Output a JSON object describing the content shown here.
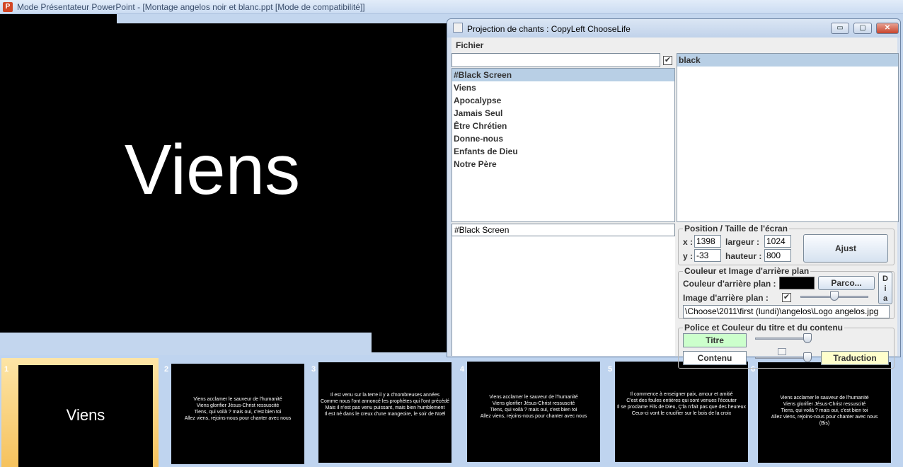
{
  "powerpoint": {
    "title": "Mode Présentateur PowerPoint - [Montage angelos noir et blanc.ppt [Mode de compatibilité]]",
    "current_slide_text": "Viens"
  },
  "slides": [
    {
      "number": "1",
      "lines": [
        "Viens"
      ]
    },
    {
      "number": "2",
      "lines": [
        "Viens acclamer le sauveur de l'humanité",
        "Viens glorifier Jésus-Christ  ressuscité",
        "Tiens, qui voilà ? mais oui, c'est bien toi",
        "Allez viens, rejoins-nous  pour chanter avec nous"
      ]
    },
    {
      "number": "3",
      "lines": [
        "Il est venu sur la terre il y a d'nombreuses années",
        "Comme nous l'ont annoncé les prophètes qui l'ont précédé",
        "Mais il n'est pas venu puissant, mais bien humblement",
        "Il est né dans le creux d'une mangeoire, le soir de Noël"
      ]
    },
    {
      "number": "4",
      "lines": [
        "Viens acclamer le sauveur de l'humanité",
        "Viens glorifier Jésus-Christ  ressuscité",
        "Tiens, qui voilà ? mais oui, c'est bien toi",
        "Allez viens, rejoins-nous  pour chanter avec nous"
      ]
    },
    {
      "number": "5",
      "lines": [
        "Il commence à enseigner paix, amour et amitié",
        "C'est des foules entières qui sont venues l'écouter",
        "Il se proclame Fils de Dieu, Ç'la n'fait pas que des heureux",
        "Ceux-ci vont le crucifier sur le bois de la croix"
      ]
    },
    {
      "number": "6",
      "lines": [
        "Viens acclamer le sauveur de l'humanité",
        "Viens glorifier Jésus-Christ  ressuscité",
        "Tiens, qui voilà ? mais oui, c'est bien toi",
        "Allez viens, rejoins-nous  pour chanter avec nous",
        "",
        "(Bis)"
      ]
    }
  ],
  "app": {
    "title": "Projection de chants : CopyLeft ChooseLife",
    "window_buttons": {
      "minimize": "▭",
      "maximize": "▢",
      "close": "✕"
    },
    "menu": {
      "fichier": "Fichier"
    },
    "search_value": "",
    "filter_checked": true,
    "songs": [
      "#Black Screen",
      "Viens",
      "Apocalypse",
      "Jamais Seul",
      "Être Chrétien",
      "Donne-nous",
      "Enfants de Dieu",
      "Notre Père"
    ],
    "selected_song": "#Black Screen",
    "slides_list": [
      "black"
    ],
    "current_title_field": "#Black Screen",
    "position": {
      "label": "Position / Taille de l'écran",
      "x_label": "x :",
      "x_value": "1398",
      "y_label": "y :",
      "y_value": "-33",
      "width_label": "largeur :",
      "width_value": "1024",
      "height_label": "hauteur :",
      "height_value": "800",
      "adjust_button": "Ajust"
    },
    "background": {
      "label": "Couleur et Image d'arrière plan",
      "color_label": "Couleur d'arrière plan :",
      "color": "#000000",
      "browse_button": "Parco...",
      "image_label": "Image d'arrière plan :",
      "image_checked": true,
      "image_path": "\\Choose\\2011\\first (lundi)\\angelos\\Logo angelos.jpg",
      "side_button": [
        "D",
        "i",
        "a"
      ]
    },
    "font": {
      "label": "Police et Couleur du titre et du contenu",
      "title_button": "Titre",
      "title_color": "#ccffcc",
      "content_button": "Contenu",
      "translation_button": "Traduction",
      "translation_color": "#ffffcc"
    }
  }
}
